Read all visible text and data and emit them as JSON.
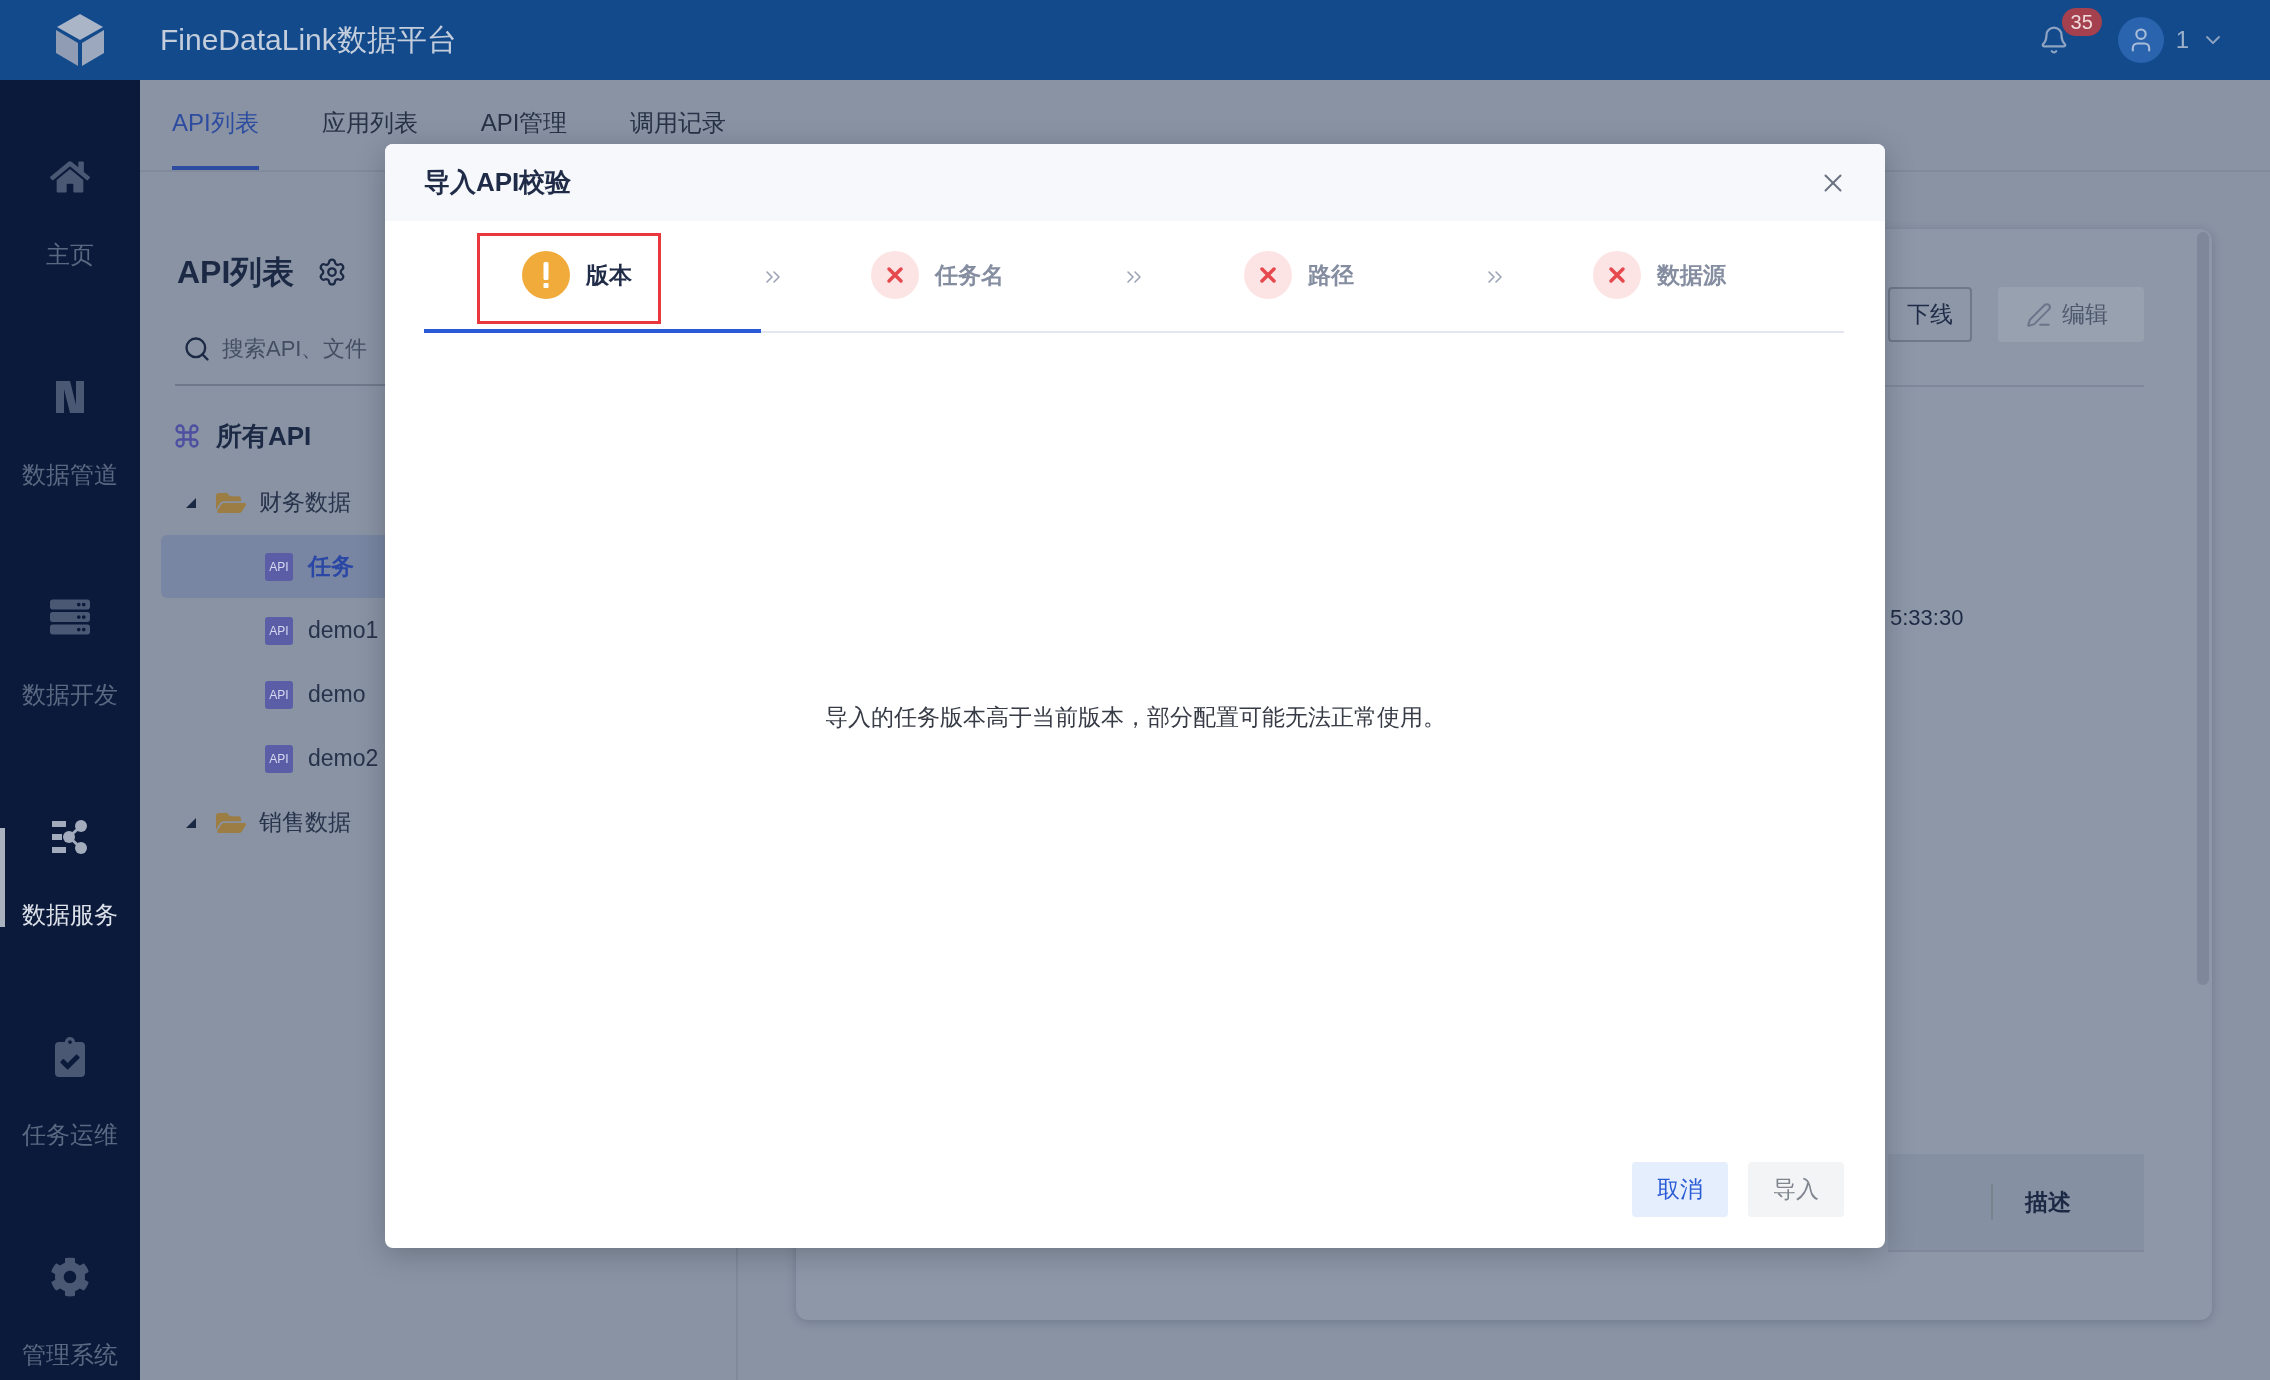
{
  "header": {
    "title": "FineDataLink数据平台",
    "notification_count": "35",
    "user_name": "1"
  },
  "nav": [
    {
      "kind": "home",
      "label": "主页",
      "selected": false
    },
    {
      "kind": "pipeline",
      "label": "数据管道",
      "selected": false
    },
    {
      "kind": "development",
      "label": "数据开发",
      "selected": false
    },
    {
      "kind": "service",
      "label": "数据服务",
      "selected": true
    },
    {
      "kind": "operations",
      "label": "任务运维",
      "selected": false
    },
    {
      "kind": "settings",
      "label": "管理系统",
      "selected": false
    }
  ],
  "tabs": [
    {
      "label": "API列表",
      "selected": true
    },
    {
      "label": "应用列表",
      "selected": false
    },
    {
      "label": "API管理",
      "selected": false
    },
    {
      "label": "调用记录",
      "selected": false
    }
  ],
  "api_panel": {
    "title": "API列表",
    "search": {
      "placeholder": "搜索API、文件"
    },
    "root": {
      "label": "所有API",
      "selected": false
    },
    "tree": [
      {
        "kind": "folder",
        "label": "财务数据",
        "expanded": true,
        "selected": false,
        "children": [
          {
            "kind": "api",
            "badge": "API",
            "label": "任务",
            "selected": true
          },
          {
            "kind": "api",
            "badge": "API",
            "label": "demo1",
            "selected": false
          },
          {
            "kind": "api",
            "badge": "API",
            "label": "demo",
            "selected": false
          },
          {
            "kind": "api",
            "badge": "API",
            "label": "demo2",
            "selected": false
          }
        ]
      },
      {
        "kind": "folder",
        "label": "销售数据",
        "expanded": true,
        "selected": false
      }
    ]
  },
  "detail": {
    "buttons": [
      {
        "kind": "offline",
        "label": "下线",
        "disabled": false
      },
      {
        "kind": "edit",
        "label": "编辑",
        "disabled": true
      }
    ],
    "value_1": "5:33:30",
    "table": {
      "columns": [
        "描述"
      ]
    }
  },
  "dialog": {
    "title": "导入API校验",
    "steps": [
      {
        "kind": "warning",
        "label": "版本",
        "selected": true,
        "highlighted": true
      },
      {
        "kind": "error",
        "label": "任务名",
        "selected": false,
        "highlighted": false
      },
      {
        "kind": "error",
        "label": "路径",
        "selected": false,
        "highlighted": false
      },
      {
        "kind": "error",
        "label": "数据源",
        "selected": false,
        "highlighted": false
      }
    ],
    "message": "导入的任务版本高于当前版本，部分配置可能无法正常使用。",
    "buttons": [
      {
        "kind": "secondary",
        "label": "取消",
        "disabled": false
      },
      {
        "kind": "primary",
        "label": "导入",
        "disabled": true
      }
    ]
  }
}
